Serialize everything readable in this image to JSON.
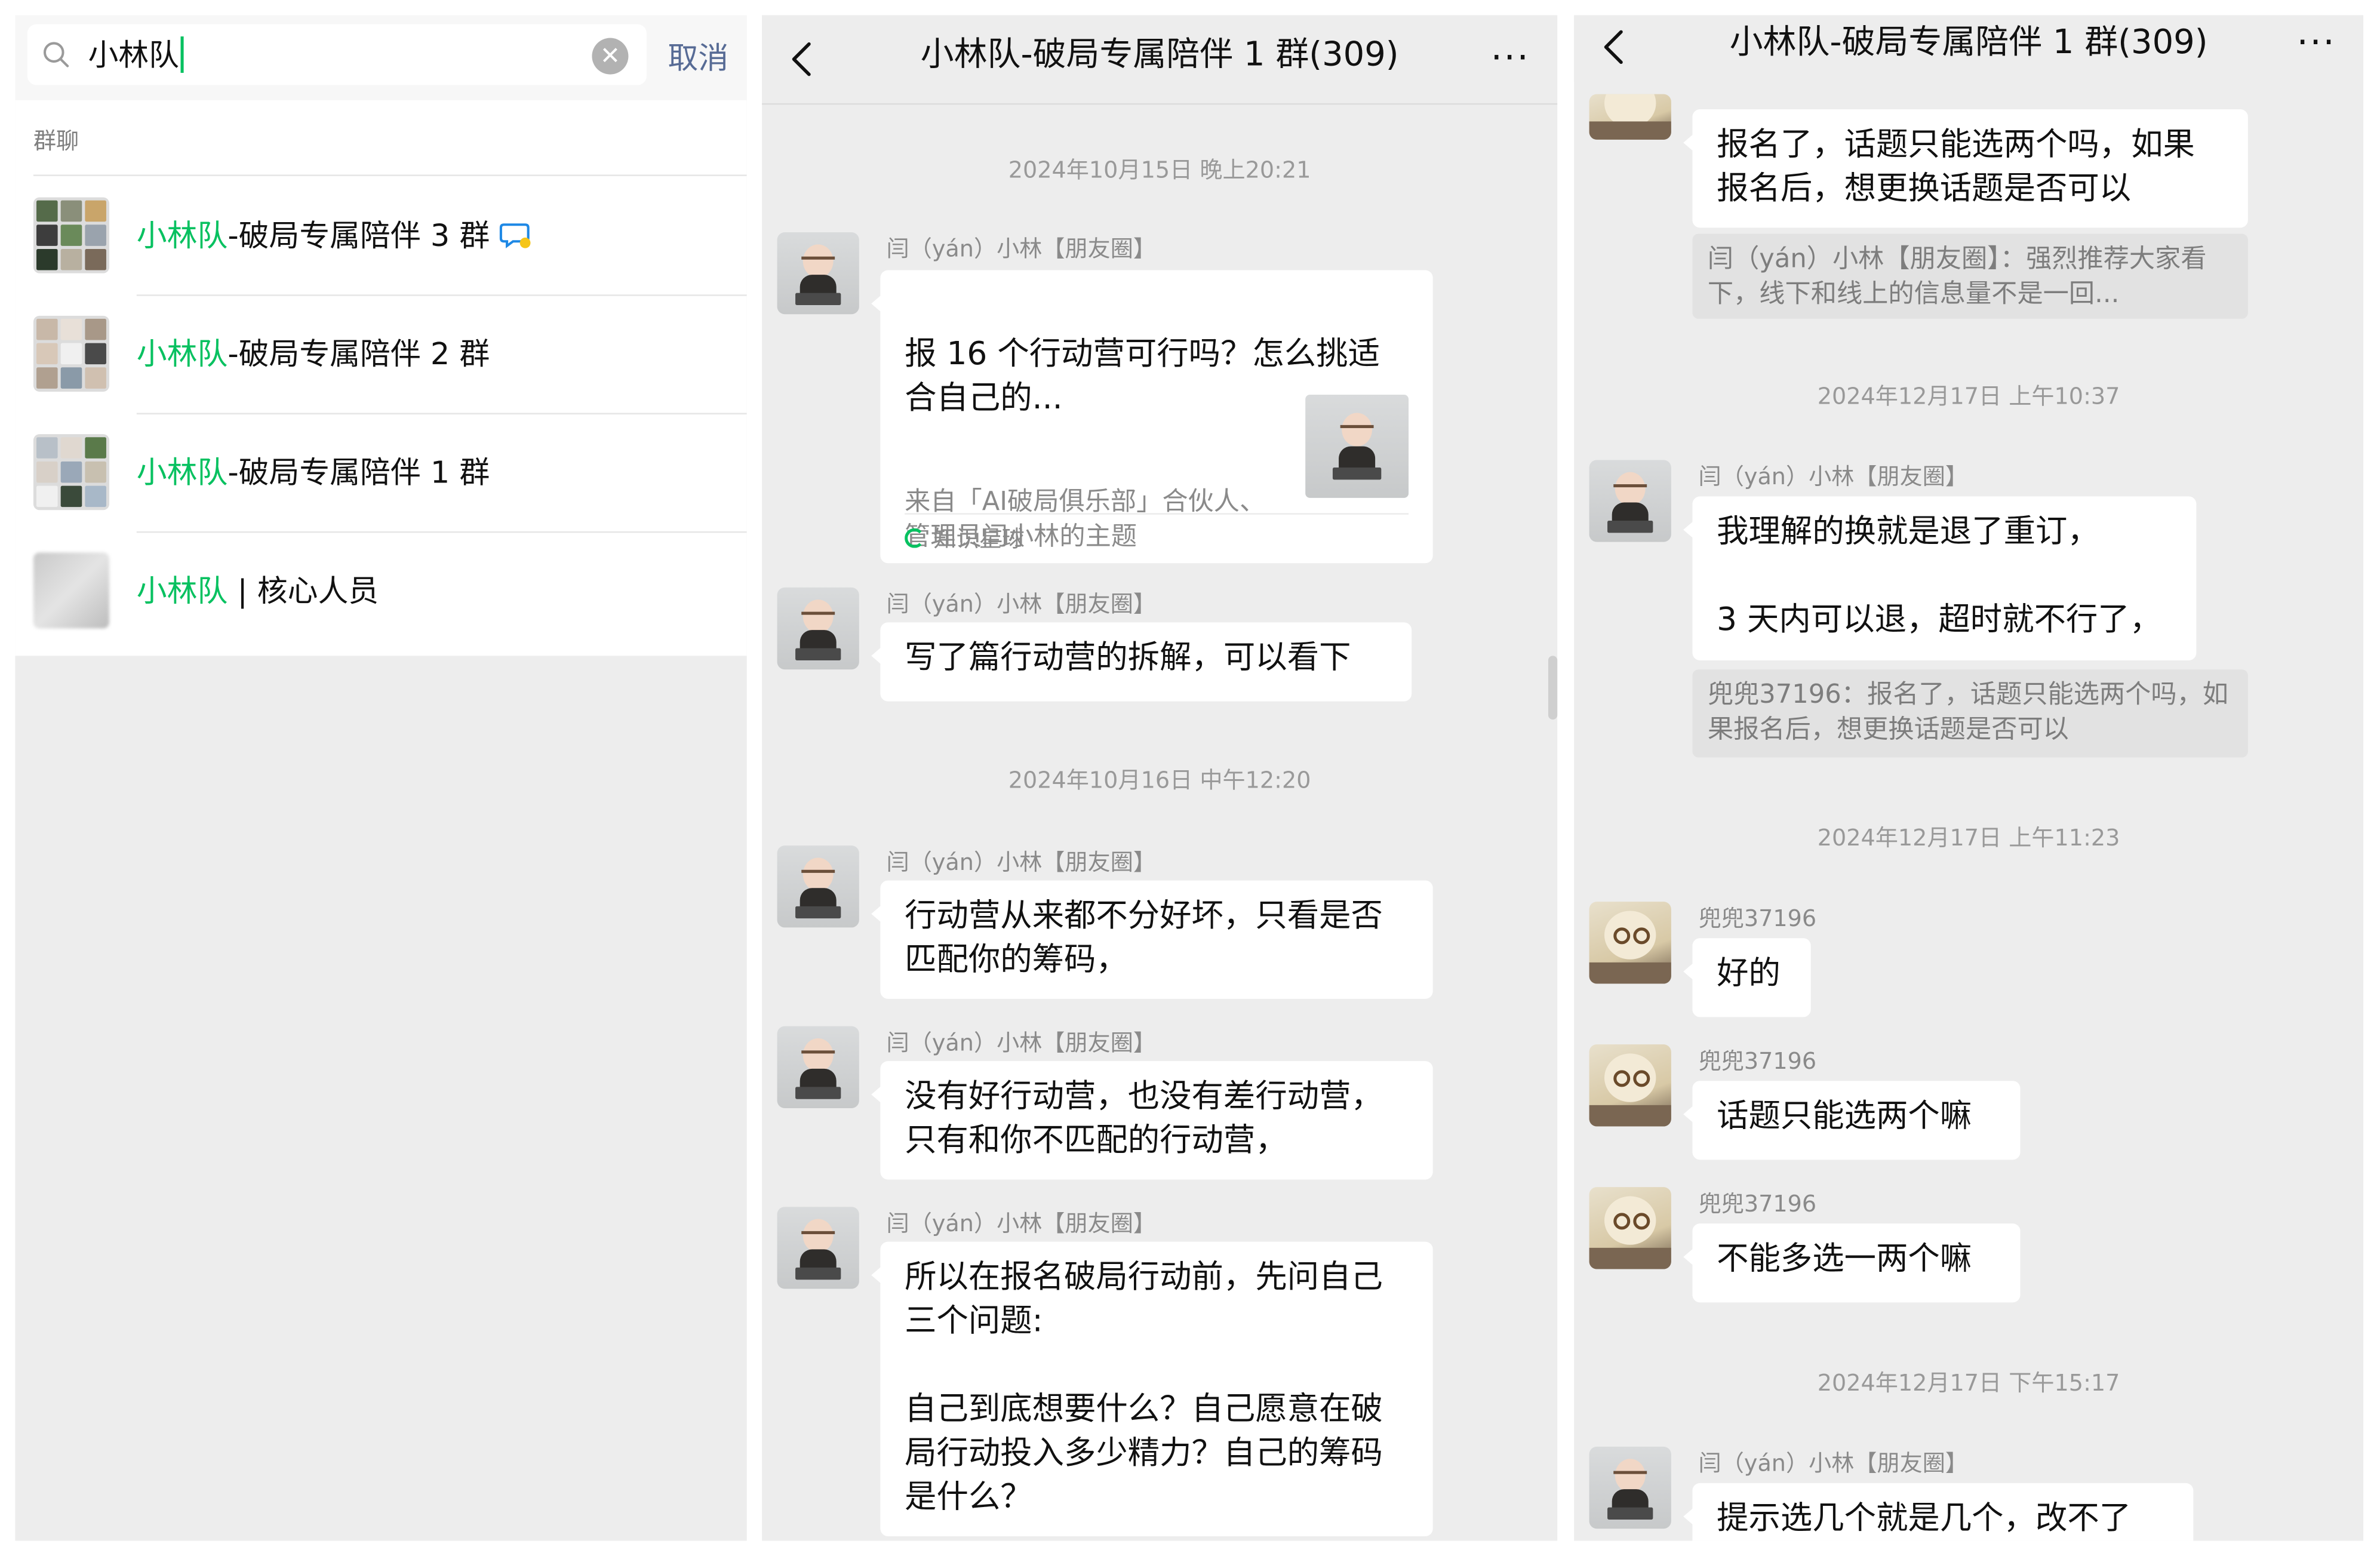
{
  "search": {
    "query": "小林队",
    "cancel_label": "取消",
    "section_label": "群聊",
    "results": [
      {
        "highlight": "小林队",
        "rest": "-破局专属陪伴 3 群"
      },
      {
        "highlight": "小林队",
        "rest": "-破局专属陪伴 2 群"
      },
      {
        "highlight": "小林队",
        "rest": "-破局专属陪伴 1 群"
      },
      {
        "highlight": "小林队",
        "rest": " | 核心人员"
      }
    ]
  },
  "chat1": {
    "title": "小林队-破局专属陪伴 1 群(309)",
    "timestamps": [
      "2024年10月15日 晚上20:21",
      "2024年10月16日 中午12:20"
    ],
    "messages": [
      {
        "sender": "闫（yán）小林【朋友圈】",
        "card_title": "报 16 个行动营可行吗？怎么挑适合自己的...",
        "card_desc": "来自「AI破局俱乐部」合伙人、管理员闫小林的主题",
        "card_source": "知识星球"
      },
      {
        "sender": "闫（yán）小林【朋友圈】",
        "text": "写了篇行动营的拆解，可以看下"
      },
      {
        "sender": "闫（yán）小林【朋友圈】",
        "text": "行动营从来都不分好坏，只看是否匹配你的筹码，"
      },
      {
        "sender": "闫（yán）小林【朋友圈】",
        "text": "没有好行动营，也没有差行动营，只有和你不匹配的行动营，"
      },
      {
        "sender": "闫（yán）小林【朋友圈】",
        "text": "所以在报名破局行动前，先问自己三个问题:\n\n自己到底想要什么？自己愿意在破局行动投入多少精力？自己的筹码是什么？"
      }
    ]
  },
  "chat2": {
    "title": "小林队-破局专属陪伴 1 群(309)",
    "timestamps": [
      "2024年12月17日 上午10:37",
      "2024年12月17日 上午11:23",
      "2024年12月17日 下午15:17"
    ],
    "messages": [
      {
        "text": "报名了，话题只能选两个吗，如果报名后，想更换话题是否可以",
        "quote": "闫（yán）小林【朋友圈】：强烈推荐大家看下，线下和线上的信息量不是一回..."
      },
      {
        "sender": "闫（yán）小林【朋友圈】",
        "text": "我理解的换就是退了重订，\n\n3 天内可以退，超时就不行了，",
        "quote": "兜兜37196：报名了，话题只能选两个吗，如果报名后，想更换话题是否可以"
      },
      {
        "sender": "兜兜37196",
        "text": "好的"
      },
      {
        "sender": "兜兜37196",
        "text": "话题只能选两个嘛"
      },
      {
        "sender": "兜兜37196",
        "text": "不能多选一两个嘛"
      },
      {
        "sender": "闫（yán）小林【朋友圈】",
        "text": "提示选几个就是几个，改不了"
      }
    ]
  },
  "colors": {
    "highlight": "#07c160",
    "link": "#576b95",
    "chat_bg": "#ededed",
    "bubble": "#ffffff",
    "meta_text": "#999999"
  },
  "icons": [
    "search-icon",
    "clear-icon",
    "back-icon",
    "more-icon",
    "chat-bubble-icon",
    "knowledge-planet-icon"
  ]
}
